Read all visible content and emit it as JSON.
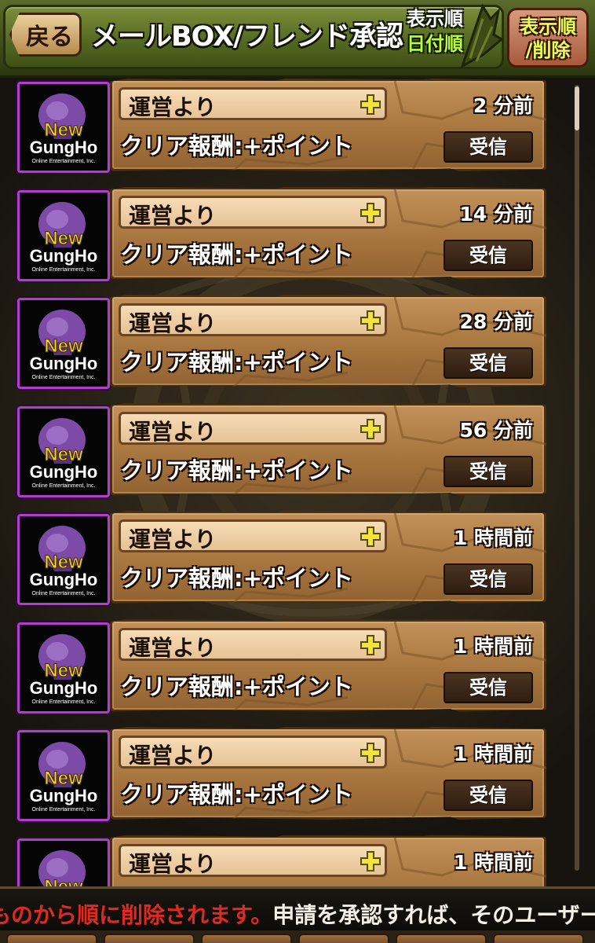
{
  "header": {
    "back_label": "戻る",
    "title": "メールBOX/フレンド承認",
    "sort_label": "表示順",
    "sort_value": "日付順",
    "order_delete_line1": "表示順",
    "order_delete_line2": "/削除"
  },
  "mails": [
    {
      "sender": "運営より",
      "subject": "クリア報酬:+ポイント",
      "elapsed": "2 分前",
      "action": "受信"
    },
    {
      "sender": "運営より",
      "subject": "クリア報酬:+ポイント",
      "elapsed": "14 分前",
      "action": "受信"
    },
    {
      "sender": "運営より",
      "subject": "クリア報酬:+ポイント",
      "elapsed": "28 分前",
      "action": "受信"
    },
    {
      "sender": "運営より",
      "subject": "クリア報酬:+ポイント",
      "elapsed": "56 分前",
      "action": "受信"
    },
    {
      "sender": "運営より",
      "subject": "クリア報酬:+ポイント",
      "elapsed": "1 時間前",
      "action": "受信"
    },
    {
      "sender": "運営より",
      "subject": "クリア報酬:+ポイント",
      "elapsed": "1 時間前",
      "action": "受信"
    },
    {
      "sender": "運営より",
      "subject": "クリア報酬:+ポイント",
      "elapsed": "1 時間前",
      "action": "受信"
    },
    {
      "sender": "運営より",
      "subject": "",
      "elapsed": "1 時間前",
      "action": ""
    }
  ],
  "avatar": {
    "logo_word1": "New",
    "logo_word2": "GungHo",
    "logo_caption": "Online Entertainment, Inc."
  },
  "ticker": {
    "red_text": "ものから順に削除されます。",
    "white_text": "申請を承認すれば、そのユーザー"
  },
  "colors": {
    "header_green": "#566a22",
    "card_brown": "#a8763f",
    "avatar_border": "#b13ec9",
    "ticker_red": "#e02a20",
    "plus_yellow": "#f2e53a"
  }
}
